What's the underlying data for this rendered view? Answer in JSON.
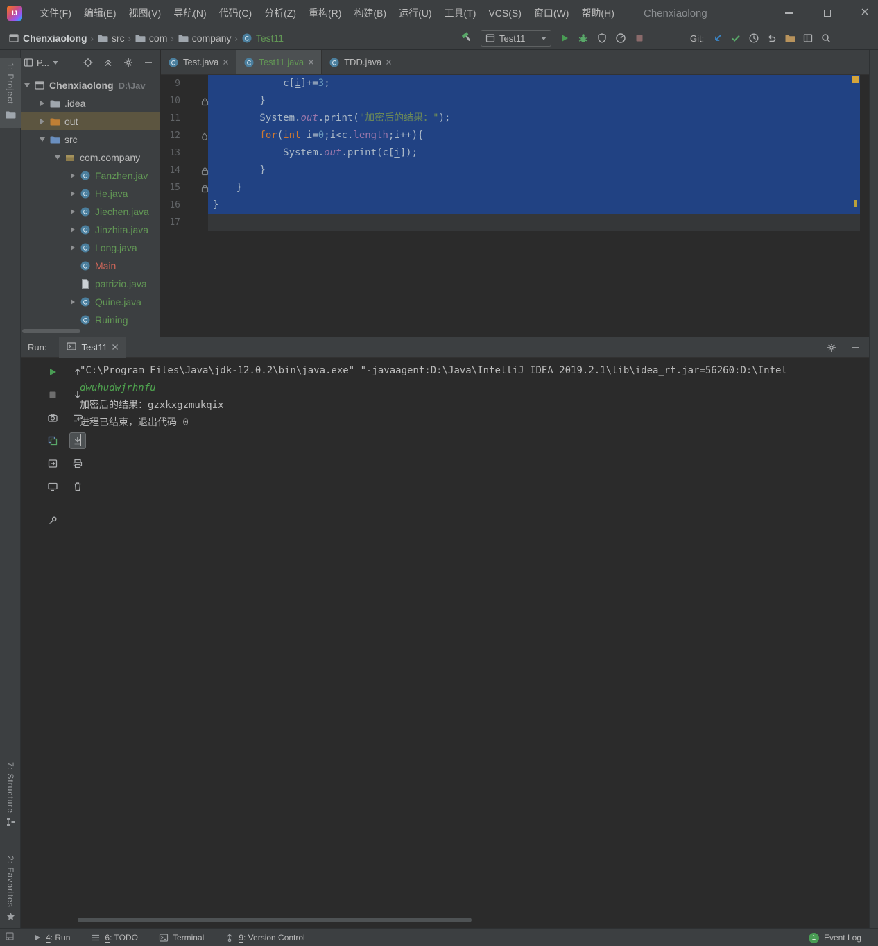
{
  "window": {
    "title": "Chenxiaolong",
    "logo_text": "IJ"
  },
  "menubar": [
    "文件(F)",
    "编辑(E)",
    "视图(V)",
    "导航(N)",
    "代码(C)",
    "分析(Z)",
    "重构(R)",
    "构建(B)",
    "运行(U)",
    "工具(T)",
    "VCS(S)",
    "窗口(W)",
    "帮助(H)"
  ],
  "navbar": {
    "breadcrumbs": [
      {
        "label": "Chenxiaolong",
        "icon": "project-icon",
        "style": "bold"
      },
      {
        "label": "src",
        "icon": "folder-icon"
      },
      {
        "label": "com",
        "icon": "folder-icon"
      },
      {
        "label": "company",
        "icon": "folder-icon"
      },
      {
        "label": "Test11",
        "icon": "class-icon",
        "style": "green"
      }
    ],
    "run_config": {
      "label": "Test11"
    },
    "actions": [
      "build-hammer-icon"
    ],
    "run_actions": [
      "run-icon",
      "debug-icon",
      "coverage-icon",
      "profiler-icon",
      "stop-disabled-icon"
    ],
    "git_label": "Git:",
    "git_actions": [
      "update-project-icon",
      "commit-icon",
      "history-icon",
      "rollback-icon",
      "diff-folder-icon",
      "layout-icon",
      "search-icon"
    ]
  },
  "left_stripe": {
    "top": {
      "label": "1: Project",
      "icon": "folder-icon"
    },
    "structure": {
      "label": "7: Structure",
      "icon": "structure-icon"
    },
    "favorites": {
      "label": "2: Favorites",
      "icon": "star-icon"
    }
  },
  "project_panel": {
    "header_label": "P...",
    "header_icons": [
      "locate-icon",
      "collapse-all-icon",
      "settings-icon",
      "hide-icon"
    ],
    "tree": [
      {
        "label": "Chenxiaolong",
        "hint": "D:\\Jav",
        "icon": "project-icon",
        "expand": "open",
        "indent": 0,
        "style": "bold"
      },
      {
        "label": ".idea",
        "icon": "folder-icon",
        "expand": "closed",
        "indent": 1
      },
      {
        "label": "out",
        "icon": "folder-out-icon",
        "expand": "closed",
        "indent": 1,
        "selected": true
      },
      {
        "label": "src",
        "icon": "folder-src-icon",
        "expand": "open",
        "indent": 1
      },
      {
        "label": "com.company",
        "icon": "package-icon",
        "expand": "open",
        "indent": 2
      },
      {
        "label": "Fanzhen.jav",
        "icon": "class-icon",
        "expand": "closed",
        "indent": 3,
        "color": "added"
      },
      {
        "label": "He.java",
        "icon": "class-icon",
        "expand": "closed",
        "indent": 3,
        "color": "added"
      },
      {
        "label": "Jiechen.java",
        "icon": "class-icon",
        "expand": "closed",
        "indent": 3,
        "color": "added"
      },
      {
        "label": "Jinzhita.java",
        "icon": "class-icon",
        "expand": "closed",
        "indent": 3,
        "color": "added"
      },
      {
        "label": "Long.java",
        "icon": "class-icon",
        "expand": "closed",
        "indent": 3,
        "color": "added"
      },
      {
        "label": "Main",
        "icon": "class-icon",
        "indent": 3,
        "color": "unversioned"
      },
      {
        "label": "patrizio.java",
        "icon": "file-icon",
        "indent": 3,
        "color": "added"
      },
      {
        "label": "Quine.java",
        "icon": "class-icon",
        "expand": "closed",
        "indent": 3,
        "color": "added"
      },
      {
        "label": "Ruining",
        "icon": "class-icon",
        "indent": 3,
        "color": "added"
      }
    ]
  },
  "editor": {
    "tabs": [
      {
        "label": "Test.java",
        "icon": "class-icon",
        "active": false,
        "green": false
      },
      {
        "label": "Test11.java",
        "icon": "class-icon",
        "active": true,
        "green": true
      },
      {
        "label": "TDD.java",
        "icon": "class-icon",
        "active": false,
        "green": false
      }
    ],
    "lines": [
      {
        "no": "9",
        "sel": true,
        "tokens": [
          [
            "p",
            "            c["
          ],
          [
            "vu",
            "i"
          ],
          [
            "p",
            "]+="
          ],
          [
            "n",
            "3"
          ],
          [
            "p",
            ";"
          ]
        ]
      },
      {
        "no": "10",
        "sel": true,
        "gicon": "lock-icon",
        "tokens": [
          [
            "p",
            "        }"
          ]
        ]
      },
      {
        "no": "11",
        "sel": true,
        "tokens": [
          [
            "p",
            "        System."
          ],
          [
            "f",
            "out"
          ],
          [
            "p",
            ".print("
          ],
          [
            "s",
            "\"加密后的结果：\""
          ],
          [
            "p",
            ");"
          ]
        ]
      },
      {
        "no": "12",
        "sel": true,
        "gicon": "drop-icon",
        "tokens": [
          [
            "p",
            "        "
          ],
          [
            "k",
            "for"
          ],
          [
            "p",
            "("
          ],
          [
            "k",
            "int"
          ],
          [
            "p",
            " "
          ],
          [
            "vu",
            "i"
          ],
          [
            "p",
            "="
          ],
          [
            "n",
            "0"
          ],
          [
            "p",
            ";"
          ],
          [
            "vu",
            "i"
          ],
          [
            "p",
            "<c."
          ],
          [
            "fp",
            "length"
          ],
          [
            "p",
            ";"
          ],
          [
            "vu",
            "i"
          ],
          [
            "p",
            "++){"
          ]
        ]
      },
      {
        "no": "13",
        "sel": true,
        "tokens": [
          [
            "p",
            "            System."
          ],
          [
            "f",
            "out"
          ],
          [
            "p",
            ".print(c["
          ],
          [
            "vu",
            "i"
          ],
          [
            "p",
            "]);"
          ]
        ]
      },
      {
        "no": "14",
        "sel": true,
        "gicon": "lock-icon",
        "tokens": [
          [
            "p",
            "        }"
          ]
        ]
      },
      {
        "no": "15",
        "sel": true,
        "gicon": "lock-icon",
        "tokens": [
          [
            "p",
            "    }"
          ]
        ]
      },
      {
        "no": "16",
        "sel": true,
        "tokens": [
          [
            "p",
            "}"
          ]
        ]
      },
      {
        "no": "17",
        "cur": true,
        "tokens": []
      }
    ]
  },
  "run_panel": {
    "label": "Run:",
    "tab": {
      "label": "Test11",
      "icon": "console-icon"
    },
    "header_icons": [
      "settings-icon",
      "hide-icon"
    ],
    "toolbar_left": [
      "rerun-icon",
      "stop-gray-icon",
      "camera-icon",
      "dump-threads-icon",
      "import-icon",
      "monitor-icon",
      "gap",
      "pin-icon"
    ],
    "toolbar_console": [
      "up-icon",
      "down-icon",
      "softwrap-icon",
      "scroll-end-icon",
      "print-icon",
      "clear-icon"
    ],
    "console": [
      {
        "type": "plain",
        "text": "\"C:\\Program Files\\Java\\jdk-12.0.2\\bin\\java.exe\" \"-javaagent:D:\\Java\\IntelliJ IDEA 2019.2.1\\lib\\idea_rt.jar=56260:D:\\Intel"
      },
      {
        "type": "input",
        "text": "dwuhudwjrhnfu"
      },
      {
        "type": "plain",
        "text": "加密后的结果：gzxkxgzmukqix"
      },
      {
        "type": "plain",
        "text": "进程已结束，退出代码 0"
      }
    ]
  },
  "statusbar": {
    "items": [
      {
        "mnemonic": "4",
        "label": ": Run",
        "icon": "run-small-icon"
      },
      {
        "mnemonic": "6",
        "label": ": TODO",
        "icon": "todo-icon"
      },
      {
        "mnemonic": "",
        "label": "Terminal",
        "icon": "terminal-icon"
      },
      {
        "mnemonic": "9",
        "label": ": Version Control",
        "icon": "vcs-icon"
      }
    ],
    "event_log": {
      "label": "Event Log",
      "badge": "1"
    }
  },
  "colors": {
    "selection": "#214283",
    "added_green": "#629755",
    "unversioned": "#D1675A",
    "keyword": "#CC7832",
    "string": "#6A8759",
    "number": "#6897BB",
    "field": "#9876AA"
  }
}
